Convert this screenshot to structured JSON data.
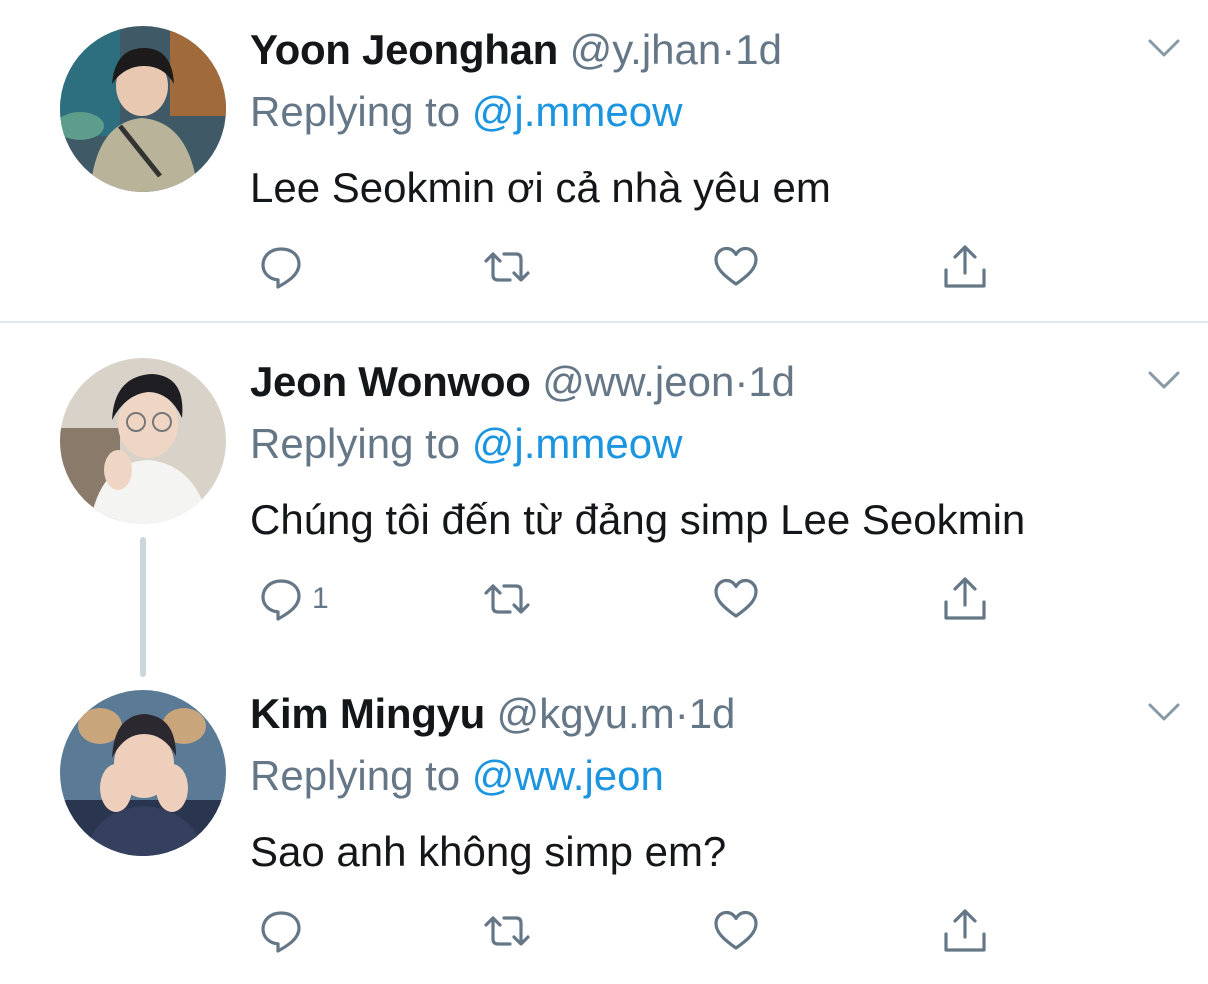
{
  "colors": {
    "text": "#14171a",
    "secondary": "#657786",
    "link": "#1b95e0",
    "divider": "#e1e8ed",
    "thread": "#ccd6dd"
  },
  "icons": {
    "reply": "reply-icon",
    "retweet": "retweet-icon",
    "like": "heart-icon",
    "share": "share-icon",
    "more": "chevron-down-icon"
  },
  "tweets": [
    {
      "name": "Yoon Jeonghan",
      "handle": "@y.jhan",
      "separator": "·",
      "time": "1d",
      "replying_prefix": "Replying to",
      "replying_to": "@j.mmeow",
      "text": "Lee Seokmin ơi cả nhà yêu em",
      "reply_count": ""
    },
    {
      "name": "Jeon Wonwoo",
      "handle": "@ww.jeon",
      "separator": "·",
      "time": "1d",
      "replying_prefix": "Replying to",
      "replying_to": "@j.mmeow",
      "text": "Chúng tôi đến từ đảng simp Lee Seokmin",
      "reply_count": "1"
    },
    {
      "name": "Kim Mingyu",
      "handle": "@kgyu.m",
      "separator": "·",
      "time": "1d",
      "replying_prefix": "Replying to",
      "replying_to": "@ww.jeon",
      "text": "Sao anh không simp em?",
      "reply_count": ""
    }
  ]
}
